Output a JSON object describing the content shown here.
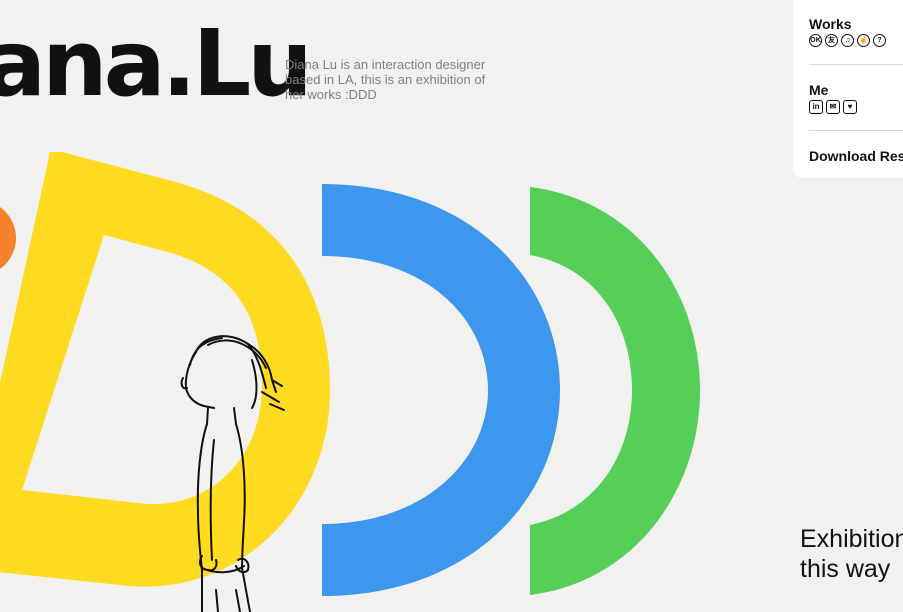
{
  "header": {
    "title": "ana.Lu",
    "intro": "Diana Lu is an interaction designer based in LA, this is an exhibition of her works :DDD"
  },
  "menu": {
    "works_label": "Works",
    "works_icons": [
      {
        "name": "ok-icon",
        "glyph": "OK"
      },
      {
        "name": "friend-icon",
        "glyph": "友"
      },
      {
        "name": "music-icon",
        "glyph": "♫"
      },
      {
        "name": "touch-icon",
        "glyph": "☝"
      },
      {
        "name": "help-icon",
        "glyph": "?"
      }
    ],
    "me_label": "Me",
    "me_icons": [
      {
        "name": "linkedin-icon",
        "glyph": "in"
      },
      {
        "name": "mail-icon",
        "glyph": "✉"
      },
      {
        "name": "twitter-icon",
        "glyph": "♥"
      }
    ],
    "download_label": "Download Resume"
  },
  "footer": {
    "line1": "Exhibition",
    "line2": "this way"
  },
  "colors": {
    "background": "#f1f1ef",
    "yellow": "#fedb21",
    "blue": "#3d97ee",
    "green": "#55cf58",
    "orange": "#f5822a"
  }
}
